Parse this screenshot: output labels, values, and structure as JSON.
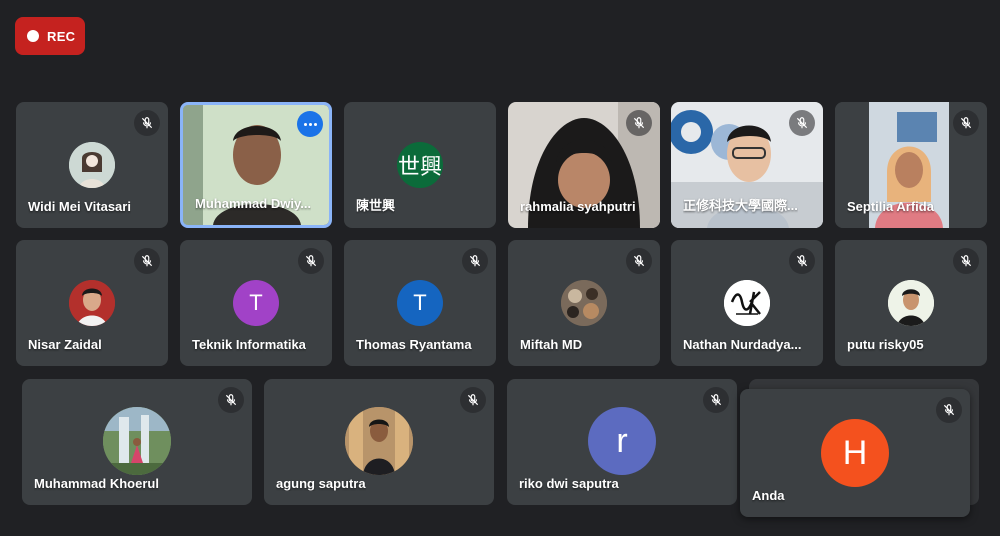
{
  "recording": {
    "label": "REC"
  },
  "participants": [
    {
      "name": "Widi Mei Vitasari",
      "muted": true
    },
    {
      "name": "Muhammad Dwiy...",
      "muted": false,
      "pinned_menu": true
    },
    {
      "name": "陳世興",
      "avatar_text": "世興",
      "avatar_color": "#0b6b3a",
      "muted": false
    },
    {
      "name": "rahmalia syahputri",
      "muted": true
    },
    {
      "name": "正修科技大學國際...",
      "muted": true
    },
    {
      "name": "Septilia Arfida",
      "muted": true
    },
    {
      "name": "Nisar Zaidal",
      "muted": true
    },
    {
      "name": "Teknik Informatika",
      "avatar_text": "T",
      "avatar_color": "#a142c7",
      "muted": true
    },
    {
      "name": "Thomas Ryantama",
      "avatar_text": "T",
      "avatar_color": "#1565c0",
      "muted": true
    },
    {
      "name": "Miftah MD",
      "muted": true
    },
    {
      "name": "Nathan Nurdadya...",
      "muted": true
    },
    {
      "name": "putu risky05",
      "muted": true
    },
    {
      "name": "Muhammad Khoerul",
      "muted": true
    },
    {
      "name": "agung saputra",
      "muted": true
    },
    {
      "name": "riko dwi saputra",
      "avatar_text": "r",
      "avatar_color": "#5c6bc0",
      "muted": true
    },
    {
      "name": "Anda",
      "avatar_text": "H",
      "avatar_color": "#f4511e",
      "muted": true
    }
  ]
}
